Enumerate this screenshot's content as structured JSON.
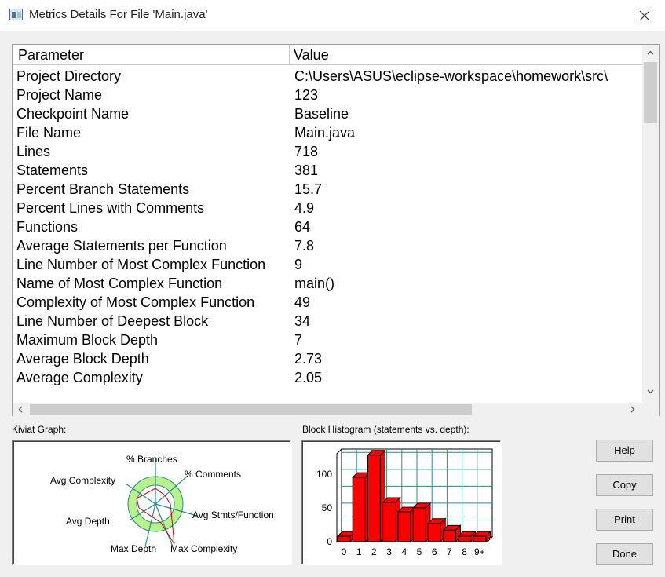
{
  "window": {
    "title": "Metrics Details For File 'Main.java'",
    "icons": {
      "app": "app-window-icon",
      "close": "close-icon"
    }
  },
  "table": {
    "columns": [
      "Parameter",
      "Value"
    ],
    "rows": [
      [
        "Project Directory",
        "C:\\Users\\ASUS\\eclipse-workspace\\homework\\src\\"
      ],
      [
        "Project Name",
        "123"
      ],
      [
        "Checkpoint Name",
        "Baseline"
      ],
      [
        "File Name",
        "Main.java"
      ],
      [
        "Lines",
        "718"
      ],
      [
        "Statements",
        "381"
      ],
      [
        "Percent Branch Statements",
        "15.7"
      ],
      [
        "Percent Lines with Comments",
        "4.9"
      ],
      [
        "Functions",
        "64"
      ],
      [
        "Average Statements per Function",
        "7.8"
      ],
      [
        "Line Number of Most Complex Function",
        "9"
      ],
      [
        "Name of Most Complex Function",
        "main()"
      ],
      [
        "Complexity of Most Complex Function",
        "49"
      ],
      [
        "Line Number of Deepest Block",
        "34"
      ],
      [
        "Maximum Block Depth",
        "7"
      ],
      [
        "Average Block Depth",
        "2.73"
      ],
      [
        "Average Complexity",
        "2.05"
      ]
    ]
  },
  "kiviat": {
    "label": "Kiviat Graph:",
    "axes": [
      "% Branches",
      "% Comments",
      "Avg Stmts/Function",
      "Max Complexity",
      "Max Depth",
      "Avg Depth",
      "Avg Complexity"
    ],
    "colors": {
      "band": "#b7f28c",
      "spokes": "#2e8a8a",
      "polygon": "#c00000"
    }
  },
  "histogram": {
    "label": "Block Histogram (statements vs. depth):",
    "colors": {
      "bar": "#ff0000",
      "grid": "#2e8a8a"
    }
  },
  "chart_data": {
    "type": "bar",
    "categories": [
      "0",
      "1",
      "2",
      "3",
      "4",
      "5",
      "6",
      "7",
      "8",
      "9+"
    ],
    "values": [
      8,
      95,
      128,
      58,
      44,
      50,
      27,
      17,
      8,
      8
    ],
    "yticks": [
      "0",
      "50",
      "100"
    ],
    "ylim": [
      0,
      130
    ]
  },
  "buttons": {
    "help": "Help",
    "copy": "Copy",
    "print": "Print",
    "done": "Done"
  }
}
